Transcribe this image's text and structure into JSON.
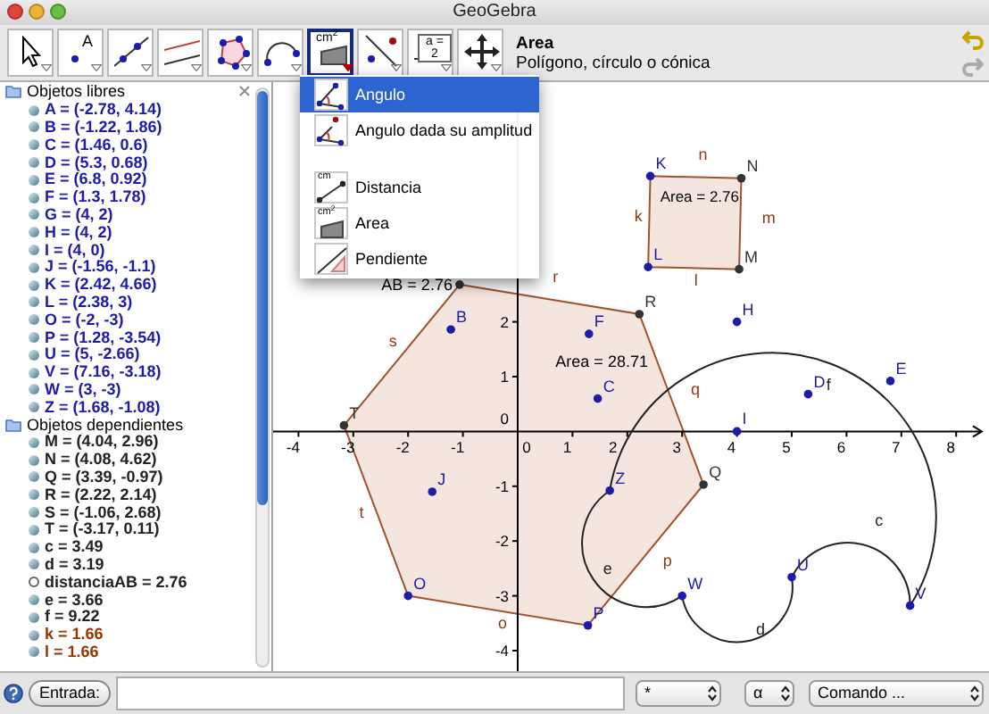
{
  "window": {
    "title": "GeoGebra"
  },
  "toolbar": {
    "tools": [
      {
        "kind": "move",
        "selected": false
      },
      {
        "kind": "point",
        "icon_text": "A",
        "selected": false
      },
      {
        "kind": "line",
        "selected": false
      },
      {
        "kind": "parallel",
        "selected": false
      },
      {
        "kind": "polygon",
        "selected": false
      },
      {
        "kind": "arc",
        "selected": false
      },
      {
        "kind": "area",
        "icon_text": "cm$^{2}$",
        "selected": true
      },
      {
        "kind": "perpendicular",
        "selected": false
      },
      {
        "kind": "slider",
        "icon_text": "a = 2",
        "selected": false
      },
      {
        "kind": "pan",
        "selected": false
      }
    ],
    "tool_name": "Area",
    "tool_help": "Polígono, círculo o cónica"
  },
  "tool_menu": [
    {
      "kind": "angle",
      "label": "Angulo",
      "selected": true
    },
    {
      "kind": "angle_fixed",
      "label": "Angulo dada su amplitud",
      "selected": false
    },
    {
      "kind": "distance",
      "icon_text": "cm",
      "label": "Distancia",
      "selected": false
    },
    {
      "kind": "area",
      "icon_text": "cm$^{2}$",
      "label": "Area",
      "selected": false
    },
    {
      "kind": "slope",
      "label": "Pendiente",
      "selected": false
    }
  ],
  "algebra_view": {
    "groups": [
      {
        "title": "Objetos libres",
        "items": [
          {
            "text": "A = (-2.78, 4.14)",
            "color": "#1c1ca8",
            "visible": true
          },
          {
            "text": "B = (-1.22, 1.86)",
            "color": "#1c1ca8",
            "visible": true
          },
          {
            "text": "C = (1.46, 0.6)",
            "color": "#1c1ca8",
            "visible": true
          },
          {
            "text": "D = (5.3, 0.68)",
            "color": "#1c1ca8",
            "visible": true
          },
          {
            "text": "E = (6.8, 0.92)",
            "color": "#1c1ca8",
            "visible": true
          },
          {
            "text": "F = (1.3, 1.78)",
            "color": "#1c1ca8",
            "visible": true
          },
          {
            "text": "G = (4, 2)",
            "color": "#1c1ca8",
            "visible": true
          },
          {
            "text": "H = (4, 2)",
            "color": "#1c1ca8",
            "visible": true
          },
          {
            "text": "I = (4, 0)",
            "color": "#1c1ca8",
            "visible": true
          },
          {
            "text": "J = (-1.56, -1.1)",
            "color": "#1c1ca8",
            "visible": true
          },
          {
            "text": "K = (2.42, 4.66)",
            "color": "#1c1ca8",
            "visible": true
          },
          {
            "text": "L = (2.38, 3)",
            "color": "#1c1ca8",
            "visible": true
          },
          {
            "text": "O = (-2, -3)",
            "color": "#1c1ca8",
            "visible": true
          },
          {
            "text": "P = (1.28, -3.54)",
            "color": "#1c1ca8",
            "visible": true
          },
          {
            "text": "U = (5, -2.66)",
            "color": "#1c1ca8",
            "visible": true
          },
          {
            "text": "V = (7.16, -3.18)",
            "color": "#1c1ca8",
            "visible": true
          },
          {
            "text": "W = (3, -3)",
            "color": "#1c1ca8",
            "visible": true
          },
          {
            "text": "Z = (1.68, -1.08)",
            "color": "#1c1ca8",
            "visible": true
          }
        ]
      },
      {
        "title": "Objetos dependientes",
        "items": [
          {
            "text": "M = (4.04, 2.96)",
            "color": "#222222",
            "visible": true
          },
          {
            "text": "N = (4.08, 4.62)",
            "color": "#222222",
            "visible": true
          },
          {
            "text": "Q = (3.39, -0.97)",
            "color": "#222222",
            "visible": true
          },
          {
            "text": "R = (2.22, 2.14)",
            "color": "#222222",
            "visible": true
          },
          {
            "text": "S = (-1.06, 2.68)",
            "color": "#222222",
            "visible": true
          },
          {
            "text": "T = (-3.17, 0.11)",
            "color": "#222222",
            "visible": true
          },
          {
            "text": "c = 3.49",
            "color": "#222222",
            "visible": true
          },
          {
            "text": "d = 3.19",
            "color": "#222222",
            "visible": true
          },
          {
            "text": "distanciaAB = 2.76",
            "color": "#222222",
            "visible": false
          },
          {
            "text": "e = 3.66",
            "color": "#222222",
            "visible": true
          },
          {
            "text": "f = 9.22",
            "color": "#222222",
            "visible": true
          },
          {
            "text": "k = 1.66",
            "color": "#993300",
            "visible": true
          },
          {
            "text": "l = 1.66",
            "color": "#993300",
            "visible": true
          }
        ]
      }
    ]
  },
  "graphics": {
    "x_ticks": [
      "-4",
      "-3",
      "-2",
      "-1",
      "0",
      "1",
      "2",
      "3",
      "4",
      "5",
      "6",
      "7",
      "8"
    ],
    "y_ticks": [
      "2",
      "1",
      "0",
      "-1",
      "-2",
      "-3",
      "-4"
    ],
    "points": [
      {
        "label": "K",
        "kind": "free"
      },
      {
        "label": "N",
        "kind": "dependent"
      },
      {
        "label": "L",
        "kind": "free"
      },
      {
        "label": "M",
        "kind": "dependent"
      },
      {
        "kind": "dependent"
      },
      {
        "label": "R",
        "kind": "dependent"
      },
      {
        "label": "H",
        "kind": "free"
      },
      {
        "label": "B",
        "kind": "free"
      },
      {
        "label": "F",
        "kind": "free"
      },
      {
        "label": "E",
        "kind": "free"
      },
      {
        "label": "D",
        "kind": "free"
      },
      {
        "label": "C",
        "kind": "free"
      },
      {
        "label": "T",
        "kind": "dependent"
      },
      {
        "label": "I",
        "kind": "free"
      },
      {
        "label": "J",
        "kind": "free"
      },
      {
        "label": "Z",
        "kind": "free"
      },
      {
        "label": "Q",
        "kind": "dependent"
      },
      {
        "label": "U",
        "kind": "free"
      },
      {
        "label": "O",
        "kind": "free"
      },
      {
        "label": "W",
        "kind": "free"
      },
      {
        "label": "V",
        "kind": "free"
      },
      {
        "label": "P",
        "kind": "free"
      }
    ],
    "segment_labels": [
      "r",
      "q",
      "p",
      "o",
      "t",
      "s",
      "n",
      "m",
      "l",
      "k"
    ],
    "arc_labels": [
      "f",
      "c",
      "d",
      "e"
    ],
    "polygon_area": "Area = 28.71",
    "square_area": "Area = 2.76",
    "distance_text": "AB = 2.76"
  },
  "input_bar": {
    "button": "Entrada:",
    "selects": [
      "*",
      "α",
      "Comando ..."
    ]
  }
}
